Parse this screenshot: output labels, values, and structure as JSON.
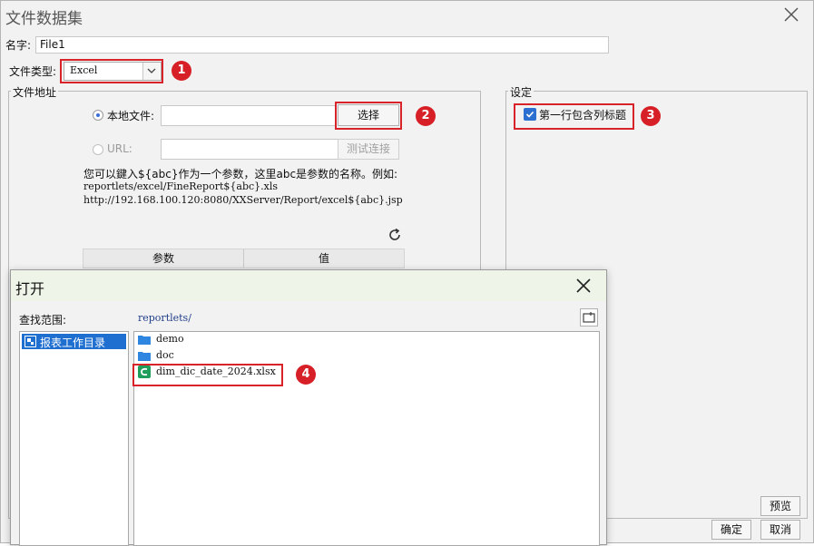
{
  "outer": {
    "title": "文件数据集",
    "name_label": "名字:",
    "name_value": "File1",
    "file_type_label": "文件类型:",
    "file_type_value": "Excel",
    "address_group_title": "文件地址",
    "local_file_label": "本地文件:",
    "choose_button": "选择",
    "url_label": "URL:",
    "test_connection_button": "测试连接",
    "hint_line1": "您可以鍵入${abc}作为一个参数，这里abc是参数的名称。例如:",
    "hint_line2": "reportlets/excel/FineReport${abc}.xls",
    "hint_line3": "http://192.168.100.120:8080/XXServer/Report/excel${abc}.jsp",
    "param_col": "参数",
    "value_col": "值",
    "settings_group_title": "设定",
    "first_row_header_label": "第一行包含列标题",
    "first_row_header_checked": true,
    "preview_button": "预览",
    "ok_button": "确定",
    "cancel_button": "取消"
  },
  "badges": [
    "1",
    "2",
    "3",
    "4"
  ],
  "open_dialog": {
    "title": "打开",
    "scope_label": "查找范围:",
    "current_path": "reportlets/",
    "left_items": [
      {
        "label": "报表工作目录",
        "selected": true
      }
    ],
    "files": [
      {
        "name": "demo",
        "type": "folder"
      },
      {
        "name": "doc",
        "type": "folder"
      },
      {
        "name": "dim_dic_date_2024.xlsx",
        "type": "excel"
      }
    ]
  },
  "colors": {
    "highlight_red": "#d9232a",
    "selection_blue": "#1f6fd1",
    "folder_blue": "#2f86e0",
    "excel_green": "#1e9e5a"
  }
}
